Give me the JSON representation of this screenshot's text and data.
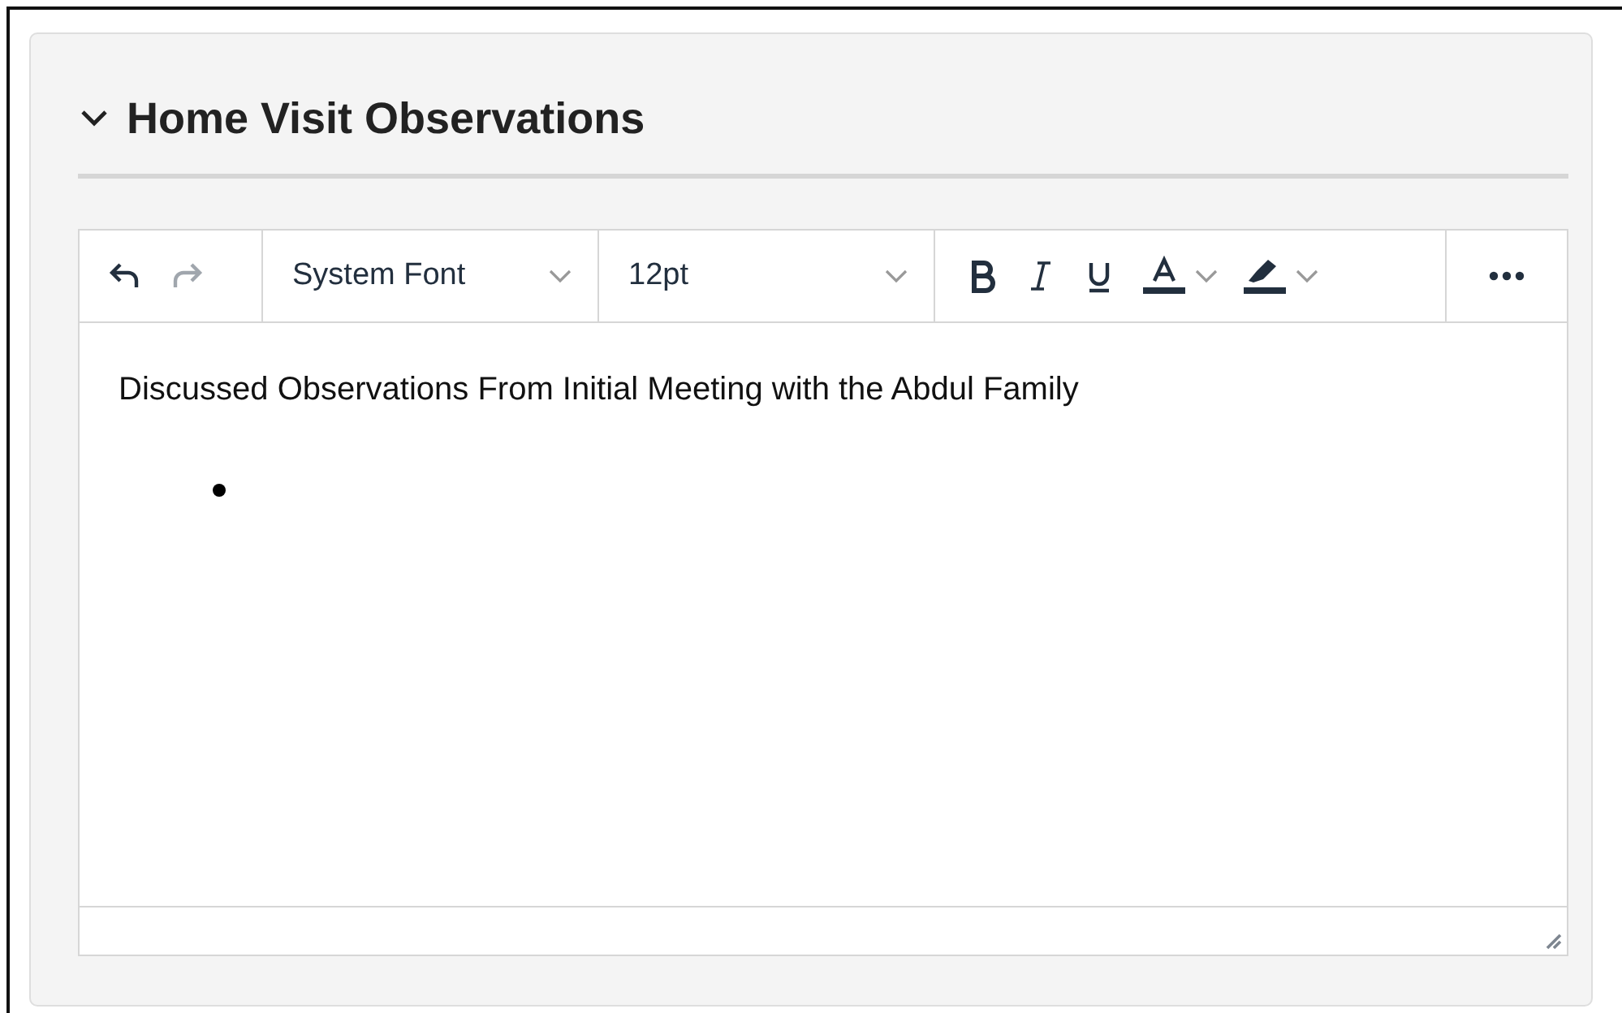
{
  "section": {
    "title": "Home Visit Observations",
    "expanded": true
  },
  "toolbar": {
    "undo": {
      "disabled": false
    },
    "redo": {
      "disabled": true
    },
    "font_family": "System Font",
    "font_size": "12pt"
  },
  "content": [
    {
      "kind": "paragraph",
      "text": "Discussed Observations From Initial Meeting with the Abdul Family"
    },
    {
      "kind": "bullet"
    }
  ]
}
